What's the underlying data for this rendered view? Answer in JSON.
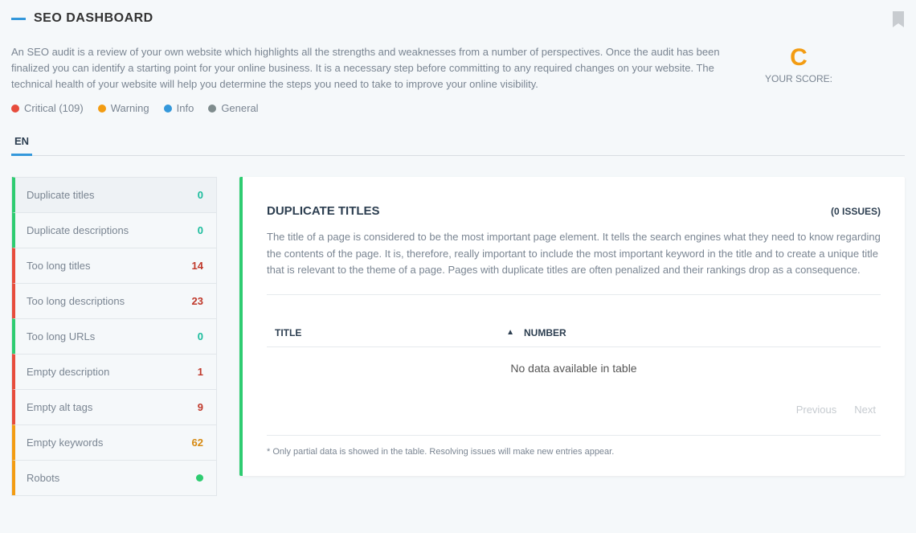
{
  "header": {
    "title": "SEO DASHBOARD",
    "description": "An SEO audit is a review of your own website which highlights all the strengths and weaknesses from a number of perspectives. Once the audit has been finalized you can identify a starting point for your online business. It is a necessary step before committing to any required changes on your website. The technical health of your website will help you determine the steps you need to take to improve your online visibility."
  },
  "score": {
    "letter": "C",
    "label": "YOUR SCORE:"
  },
  "legend": {
    "critical": "Critical (109)",
    "warning": "Warning",
    "info": "Info",
    "general": "General"
  },
  "tabs": {
    "active": "EN"
  },
  "sidebar": {
    "items": [
      {
        "label": "Duplicate titles",
        "count": "0",
        "countClass": "",
        "border": "bl-green",
        "active": true
      },
      {
        "label": "Duplicate descriptions",
        "count": "0",
        "countClass": "",
        "border": "bl-green"
      },
      {
        "label": "Too long titles",
        "count": "14",
        "countClass": "red",
        "border": "bl-red"
      },
      {
        "label": "Too long descriptions",
        "count": "23",
        "countClass": "red",
        "border": "bl-red"
      },
      {
        "label": "Too long URLs",
        "count": "0",
        "countClass": "",
        "border": "bl-green"
      },
      {
        "label": "Empty description",
        "count": "1",
        "countClass": "red",
        "border": "bl-red"
      },
      {
        "label": "Empty alt tags",
        "count": "9",
        "countClass": "red",
        "border": "bl-red"
      },
      {
        "label": "Empty keywords",
        "count": "62",
        "countClass": "orange",
        "border": "bl-orange"
      },
      {
        "label": "Robots",
        "markerColor": "#2ecc71",
        "border": "bl-orange"
      }
    ]
  },
  "panel": {
    "title": "DUPLICATE TITLES",
    "issues": "(0 ISSUES)",
    "description": "The title of a page is considered to be the most important page element. It tells the search engines what they need to know regarding the contents of the page. It is, therefore, really important to include the most important keyword in the title and to create a unique title that is relevant to the theme of a page. Pages with duplicate titles are often penalized and their rankings drop as a consequence.",
    "table": {
      "col_title": "TITLE",
      "col_number": "NUMBER",
      "empty": "No data available in table"
    },
    "pager": {
      "prev": "Previous",
      "next": "Next"
    },
    "footnote": "* Only partial data is showed in the table. Resolving issues will make new entries appear."
  }
}
